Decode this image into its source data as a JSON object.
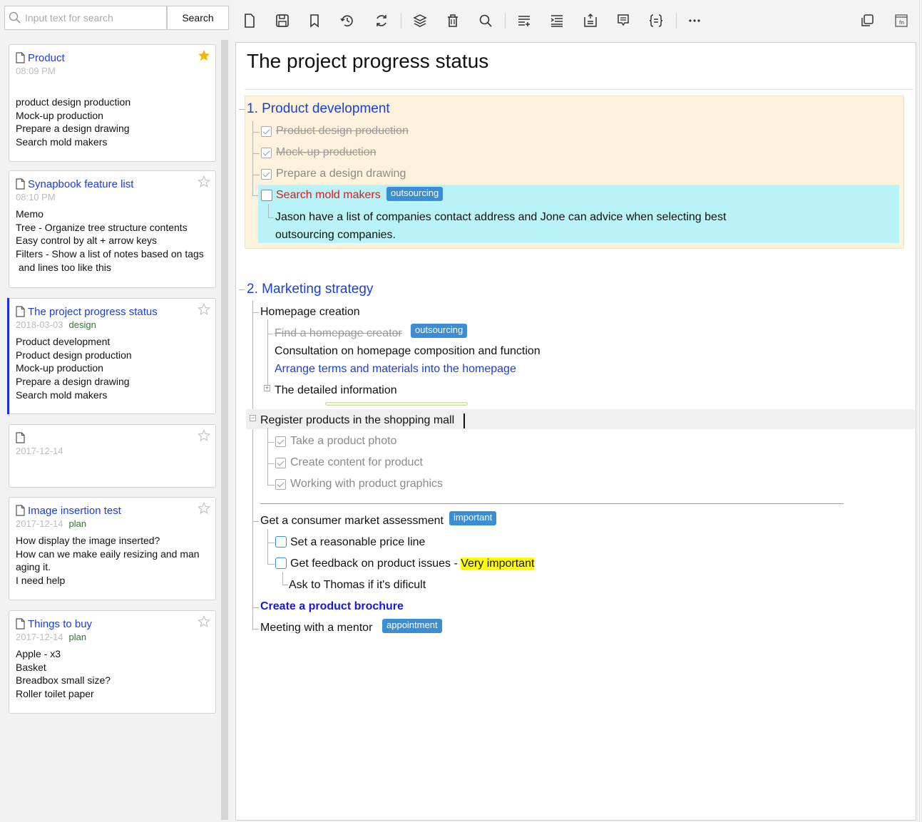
{
  "search": {
    "placeholder": "Input text for search",
    "button_label": "Search"
  },
  "notes": [
    {
      "title": "Product",
      "meta": "08:09 PM",
      "tag": "",
      "starred": true,
      "lines": [
        "product design production",
        "Mock-up production",
        "Prepare a design drawing",
        "Search mold makers"
      ]
    },
    {
      "title": "Synapbook feature list",
      "meta": "08:10 PM",
      "tag": "",
      "starred": false,
      "lines": [
        "Memo",
        "Tree - Organize tree structure contents",
        "Easy control by alt + arrow keys",
        "Filters - Show a list of notes based on tags",
        " and lines too like this"
      ]
    },
    {
      "title": "The project progress status",
      "meta": "2018-03-03",
      "tag": "design",
      "starred": false,
      "lines": [
        "Product development",
        "Product design production",
        "Mock-up production",
        "Prepare a design drawing",
        "Search mold makers"
      ]
    },
    {
      "title": "",
      "meta": "2017-12-14",
      "tag": "",
      "starred": false,
      "lines": []
    },
    {
      "title": "Image insertion test",
      "meta": "2017-12-14",
      "tag": "plan",
      "starred": false,
      "lines": [
        "How display the image inserted?",
        "How can we make eaily resizing and man",
        "aging it.",
        "I need help"
      ]
    },
    {
      "title": "Things to buy",
      "meta": "2017-12-14",
      "tag": "plan",
      "starred": false,
      "lines": [
        "Apple - x3",
        "Basket",
        "Breadbox small size?",
        "Roller toilet paper"
      ]
    }
  ],
  "toolbar": {
    "icons": [
      "new-note-icon",
      "save-icon",
      "bookmark-icon",
      "history-icon",
      "sync-icon",
      "layers-icon",
      "delete-icon",
      "find-icon",
      "add-line-icon",
      "indent-icon",
      "align-box-icon",
      "comment-icon",
      "code-braces-icon",
      "more-icon",
      "copy-window-icon",
      "fn-icon"
    ]
  },
  "doc": {
    "title": "The project progress status",
    "section1": {
      "heading": "1. Product development",
      "items": [
        "Product design production",
        "Mock-up production",
        "Prepare a design drawing"
      ],
      "active_item": "Search mold makers",
      "active_tag": "outsourcing",
      "note_line1": "Jason have a list of companies contact address and Jone can advice when selecting best",
      "note_line2": "outsourcing companies."
    },
    "section2": {
      "heading": "2. Marketing strategy",
      "homepage": "Homepage creation",
      "find_creator": "Find a homepage creator",
      "find_tag": "outsourcing",
      "consultation": "Consultation on homepage composition and function",
      "arrange": "Arrange terms and materials into the homepage",
      "detailed": "The detailed information",
      "register": "Register products in the shopping mall",
      "reg_items": [
        "Take a product photo",
        "Create content for product",
        "Working with product graphics"
      ],
      "assessment": "Get a consumer market assessment",
      "assessment_tag": "important",
      "price": "Set a reasonable price line",
      "feedback": "Get feedback on product issues - ",
      "feedback_highlight": "Very important",
      "ask": "Ask to Thomas if it's dificult",
      "brochure": "Create a product brochure",
      "mentor": "Meeting with a mentor",
      "mentor_tag": "appointment"
    }
  },
  "colors": {
    "link_blue": "#1a3fd8",
    "badge_blue": "#3b8ed4",
    "section_bg": "#fdf3dc",
    "active_bg": "#b9f3f8",
    "star_gold": "#f5b400",
    "highlight": "#ffff00",
    "active_card_bar": "#1a2fe8"
  }
}
